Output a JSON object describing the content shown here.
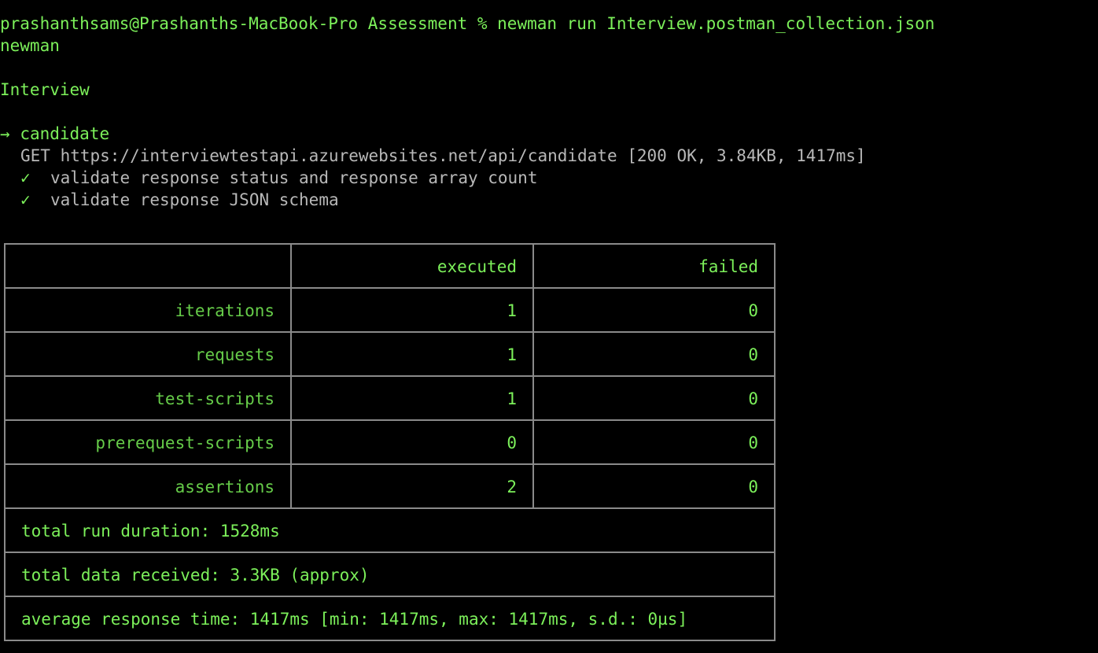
{
  "terminal": {
    "prompt": "prashanthsams@Prashanths-MacBook-Pro Assessment % newman run Interview.postman_collection.json",
    "tool_name": "newman",
    "collection_name": "Interview",
    "arrow": "→",
    "request_name": "candidate",
    "request_line": "GET https://interviewtestapi.azurewebsites.net/api/candidate [200 OK, 3.84KB, 1417ms]",
    "check_mark": "✓",
    "assertions": [
      "validate response status and response array count",
      "validate response JSON schema"
    ]
  },
  "summary": {
    "headers": [
      "",
      "executed",
      "failed"
    ],
    "rows": [
      {
        "label": "iterations",
        "executed": "1",
        "failed": "0"
      },
      {
        "label": "requests",
        "executed": "1",
        "failed": "0"
      },
      {
        "label": "test-scripts",
        "executed": "1",
        "failed": "0"
      },
      {
        "label": "prerequest-scripts",
        "executed": "0",
        "failed": "0"
      },
      {
        "label": "assertions",
        "executed": "2",
        "failed": "0"
      }
    ],
    "total_run_duration": "total run duration: 1528ms",
    "total_data_received": "total data received: 3.3KB (approx)",
    "average_response_time": "average response time: 1417ms [min: 1417ms, max: 1417ms, s.d.: 0µs]"
  },
  "colors": {
    "background": "#000000",
    "text_green": "#7cf05a",
    "text_gray": "#b8b8b8",
    "border_gray": "#8a8a8a"
  }
}
